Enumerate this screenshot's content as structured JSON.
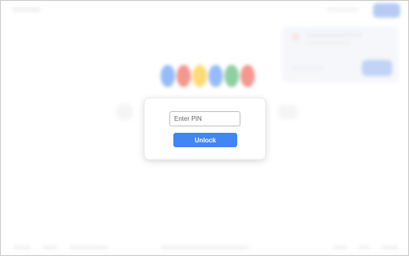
{
  "pin_dialog": {
    "pin_input_value": "",
    "pin_input_placeholder": "Enter PIN",
    "unlock_label": "Unlock"
  },
  "colors": {
    "unlock_button": "#4285f4",
    "page_background": "#ffffff"
  },
  "background_page": {
    "state": "blurred",
    "logo_colors": [
      "#4285f4",
      "#ea4335",
      "#fbbc05",
      "#4285f4",
      "#34a853",
      "#ea4335"
    ]
  }
}
